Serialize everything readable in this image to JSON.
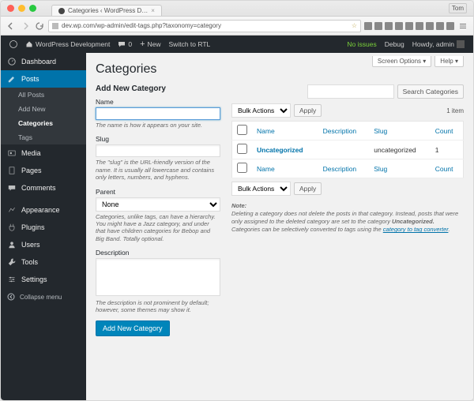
{
  "browser": {
    "tab_title": "Categories ‹ WordPress D…",
    "url": "dev.wp.com/wp-admin/edit-tags.php?taxonomy=category",
    "user_label": "Tom"
  },
  "adminbar": {
    "site": "WordPress Development",
    "comments": "0",
    "new": "New",
    "rtl": "Switch to RTL",
    "noissues": "No issues",
    "debug": "Debug",
    "howdy": "Howdy, admin"
  },
  "sidebar": {
    "items": [
      {
        "label": "Dashboard"
      },
      {
        "label": "Posts"
      },
      {
        "label": "Media"
      },
      {
        "label": "Pages"
      },
      {
        "label": "Comments"
      },
      {
        "label": "Appearance"
      },
      {
        "label": "Plugins"
      },
      {
        "label": "Users"
      },
      {
        "label": "Tools"
      },
      {
        "label": "Settings"
      }
    ],
    "posts_sub": [
      {
        "label": "All Posts"
      },
      {
        "label": "Add New"
      },
      {
        "label": "Categories"
      },
      {
        "label": "Tags"
      }
    ],
    "collapse": "Collapse menu"
  },
  "screen": {
    "options": "Screen Options",
    "help": "Help",
    "title": "Categories"
  },
  "form": {
    "title": "Add New Category",
    "name_label": "Name",
    "name_desc": "The name is how it appears on your site.",
    "slug_label": "Slug",
    "slug_desc": "The \"slug\" is the URL-friendly version of the name. It is usually all lowercase and contains only letters, numbers, and hyphens.",
    "parent_label": "Parent",
    "parent_value": "None",
    "parent_desc": "Categories, unlike tags, can have a hierarchy. You might have a Jazz category, and under that have children categories for Bebop and Big Band. Totally optional.",
    "desc_label": "Description",
    "desc_desc": "The description is not prominent by default; however, some themes may show it.",
    "submit": "Add New Category"
  },
  "table": {
    "search_btn": "Search Categories",
    "bulk": "Bulk Actions",
    "apply": "Apply",
    "count": "1 item",
    "cols": {
      "name": "Name",
      "description": "Description",
      "slug": "Slug",
      "count": "Count"
    },
    "rows": [
      {
        "name": "Uncategorized",
        "description": "",
        "slug": "uncategorized",
        "count": "1"
      }
    ],
    "note_label": "Note:",
    "note1a": "Deleting a category does not delete the posts in that category. Instead, posts that were only assigned to the deleted category are set to the category ",
    "note1b": "Uncategorized.",
    "note2a": "Categories can be selectively converted to tags using the ",
    "note2b": "category to tag converter",
    "note2c": "."
  }
}
